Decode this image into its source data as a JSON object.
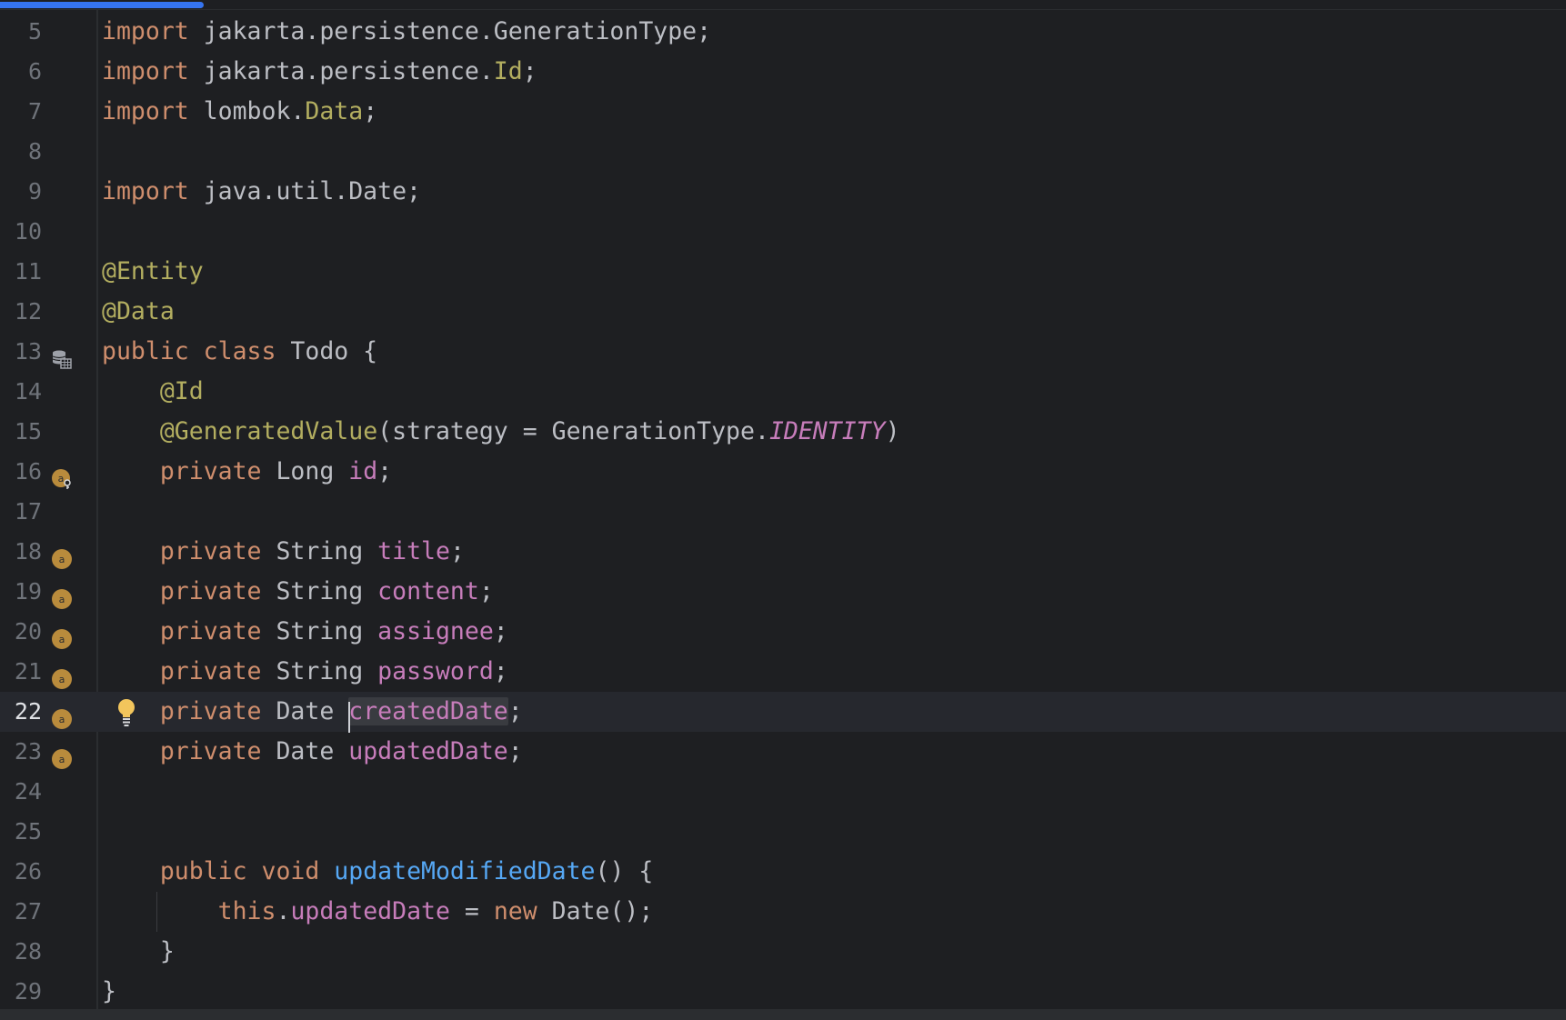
{
  "editor": {
    "progress_fraction": 0.13,
    "current_line": "22",
    "lines": [
      {
        "n": "5",
        "tokens": [
          {
            "t": "import",
            "c": "kw"
          },
          {
            "t": " jakarta.persistence.GenerationType;",
            "c": "plain"
          }
        ]
      },
      {
        "n": "6",
        "tokens": [
          {
            "t": "import",
            "c": "kw"
          },
          {
            "t": " jakarta.persistence.",
            "c": "plain"
          },
          {
            "t": "Id",
            "c": "ann"
          },
          {
            "t": ";",
            "c": "plain"
          }
        ]
      },
      {
        "n": "7",
        "tokens": [
          {
            "t": "import",
            "c": "kw"
          },
          {
            "t": " lombok.",
            "c": "plain"
          },
          {
            "t": "Data",
            "c": "ann"
          },
          {
            "t": ";",
            "c": "plain"
          }
        ]
      },
      {
        "n": "8",
        "tokens": []
      },
      {
        "n": "9",
        "tokens": [
          {
            "t": "import",
            "c": "kw"
          },
          {
            "t": " java.util.Date;",
            "c": "plain"
          }
        ]
      },
      {
        "n": "10",
        "tokens": []
      },
      {
        "n": "11",
        "tokens": [
          {
            "t": "@Entity",
            "c": "ann"
          }
        ]
      },
      {
        "n": "12",
        "tokens": [
          {
            "t": "@Data",
            "c": "ann"
          }
        ]
      },
      {
        "n": "13",
        "icon": "database-entity-icon",
        "tokens": [
          {
            "t": "public class",
            "c": "kw"
          },
          {
            "t": " Todo {",
            "c": "plain"
          }
        ]
      },
      {
        "n": "14",
        "tokens": [
          {
            "t": "    ",
            "c": "plain"
          },
          {
            "t": "@Id",
            "c": "ann"
          }
        ]
      },
      {
        "n": "15",
        "tokens": [
          {
            "t": "    ",
            "c": "plain"
          },
          {
            "t": "@GeneratedValue",
            "c": "ann"
          },
          {
            "t": "(strategy = GenerationType.",
            "c": "plain"
          },
          {
            "t": "IDENTITY",
            "c": "const"
          },
          {
            "t": ")",
            "c": "plain"
          }
        ]
      },
      {
        "n": "16",
        "icon": "field-id-icon",
        "tokens": [
          {
            "t": "    ",
            "c": "plain"
          },
          {
            "t": "private",
            "c": "kw"
          },
          {
            "t": " Long ",
            "c": "plain"
          },
          {
            "t": "id",
            "c": "fld"
          },
          {
            "t": ";",
            "c": "plain"
          }
        ]
      },
      {
        "n": "17",
        "tokens": []
      },
      {
        "n": "18",
        "icon": "field-attribute-icon",
        "tokens": [
          {
            "t": "    ",
            "c": "plain"
          },
          {
            "t": "private",
            "c": "kw"
          },
          {
            "t": " String ",
            "c": "plain"
          },
          {
            "t": "title",
            "c": "fld"
          },
          {
            "t": ";",
            "c": "plain"
          }
        ]
      },
      {
        "n": "19",
        "icon": "field-attribute-icon",
        "tokens": [
          {
            "t": "    ",
            "c": "plain"
          },
          {
            "t": "private",
            "c": "kw"
          },
          {
            "t": " String ",
            "c": "plain"
          },
          {
            "t": "content",
            "c": "fld"
          },
          {
            "t": ";",
            "c": "plain"
          }
        ]
      },
      {
        "n": "20",
        "icon": "field-attribute-icon",
        "tokens": [
          {
            "t": "    ",
            "c": "plain"
          },
          {
            "t": "private",
            "c": "kw"
          },
          {
            "t": " String ",
            "c": "plain"
          },
          {
            "t": "assignee",
            "c": "fld"
          },
          {
            "t": ";",
            "c": "plain"
          }
        ]
      },
      {
        "n": "21",
        "icon": "field-attribute-icon",
        "tokens": [
          {
            "t": "    ",
            "c": "plain"
          },
          {
            "t": "private",
            "c": "kw"
          },
          {
            "t": " String ",
            "c": "plain"
          },
          {
            "t": "password",
            "c": "fld"
          },
          {
            "t": ";",
            "c": "plain"
          }
        ]
      },
      {
        "n": "22",
        "icon": "field-attribute-icon",
        "current": true,
        "bulb": "lightbulb-icon",
        "tokens": [
          {
            "t": "    ",
            "c": "plain"
          },
          {
            "t": "private",
            "c": "kw"
          },
          {
            "t": " Date ",
            "c": "plain"
          },
          {
            "t": "createdDate",
            "c": "fld",
            "caret": true,
            "hl": true
          },
          {
            "t": ";",
            "c": "plain"
          }
        ]
      },
      {
        "n": "23",
        "icon": "field-attribute-icon",
        "tokens": [
          {
            "t": "    ",
            "c": "plain"
          },
          {
            "t": "private",
            "c": "kw"
          },
          {
            "t": " Date ",
            "c": "plain"
          },
          {
            "t": "updatedDate",
            "c": "fld"
          },
          {
            "t": ";",
            "c": "plain"
          }
        ]
      },
      {
        "n": "24",
        "tokens": []
      },
      {
        "n": "25",
        "tokens": []
      },
      {
        "n": "26",
        "tokens": [
          {
            "t": "    ",
            "c": "plain"
          },
          {
            "t": "public void",
            "c": "kw"
          },
          {
            "t": " ",
            "c": "plain"
          },
          {
            "t": "updateModifiedDate",
            "c": "fn"
          },
          {
            "t": "() {",
            "c": "plain"
          }
        ]
      },
      {
        "n": "27",
        "guide": true,
        "tokens": [
          {
            "t": "        ",
            "c": "plain"
          },
          {
            "t": "this",
            "c": "kw"
          },
          {
            "t": ".",
            "c": "plain"
          },
          {
            "t": "updatedDate",
            "c": "fld"
          },
          {
            "t": " = ",
            "c": "plain"
          },
          {
            "t": "new",
            "c": "kw"
          },
          {
            "t": " Date();",
            "c": "plain"
          }
        ]
      },
      {
        "n": "28",
        "tokens": [
          {
            "t": "    }",
            "c": "plain"
          }
        ]
      },
      {
        "n": "29",
        "tokens": [
          {
            "t": "}",
            "c": "plain"
          }
        ]
      }
    ]
  }
}
